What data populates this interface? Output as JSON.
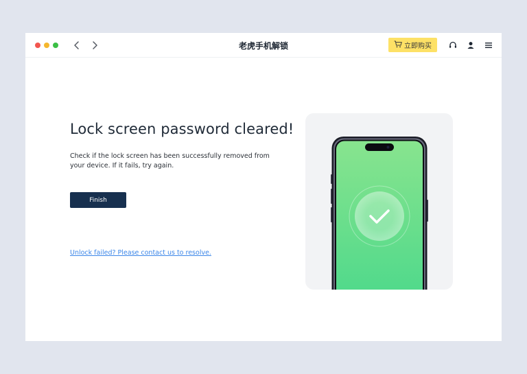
{
  "app": {
    "title": "老虎手机解锁"
  },
  "toolbar": {
    "buy_label": "立即购买",
    "icons": [
      "back-icon",
      "forward-icon",
      "cart-icon",
      "headset-icon",
      "user-icon",
      "menu-icon"
    ]
  },
  "main": {
    "heading": "Lock screen password cleared!",
    "description": "Check if the lock screen has been successfully removed from your device. If it fails, try again.",
    "finish_label": "Finish",
    "help_link": "Unlock failed? Please contact us to resolve."
  },
  "colors": {
    "background": "#e1e5ee",
    "buy_button": "#fde166",
    "finish_button": "#17304f",
    "link": "#3b86e8",
    "phone_screen": "#5fd98c"
  }
}
